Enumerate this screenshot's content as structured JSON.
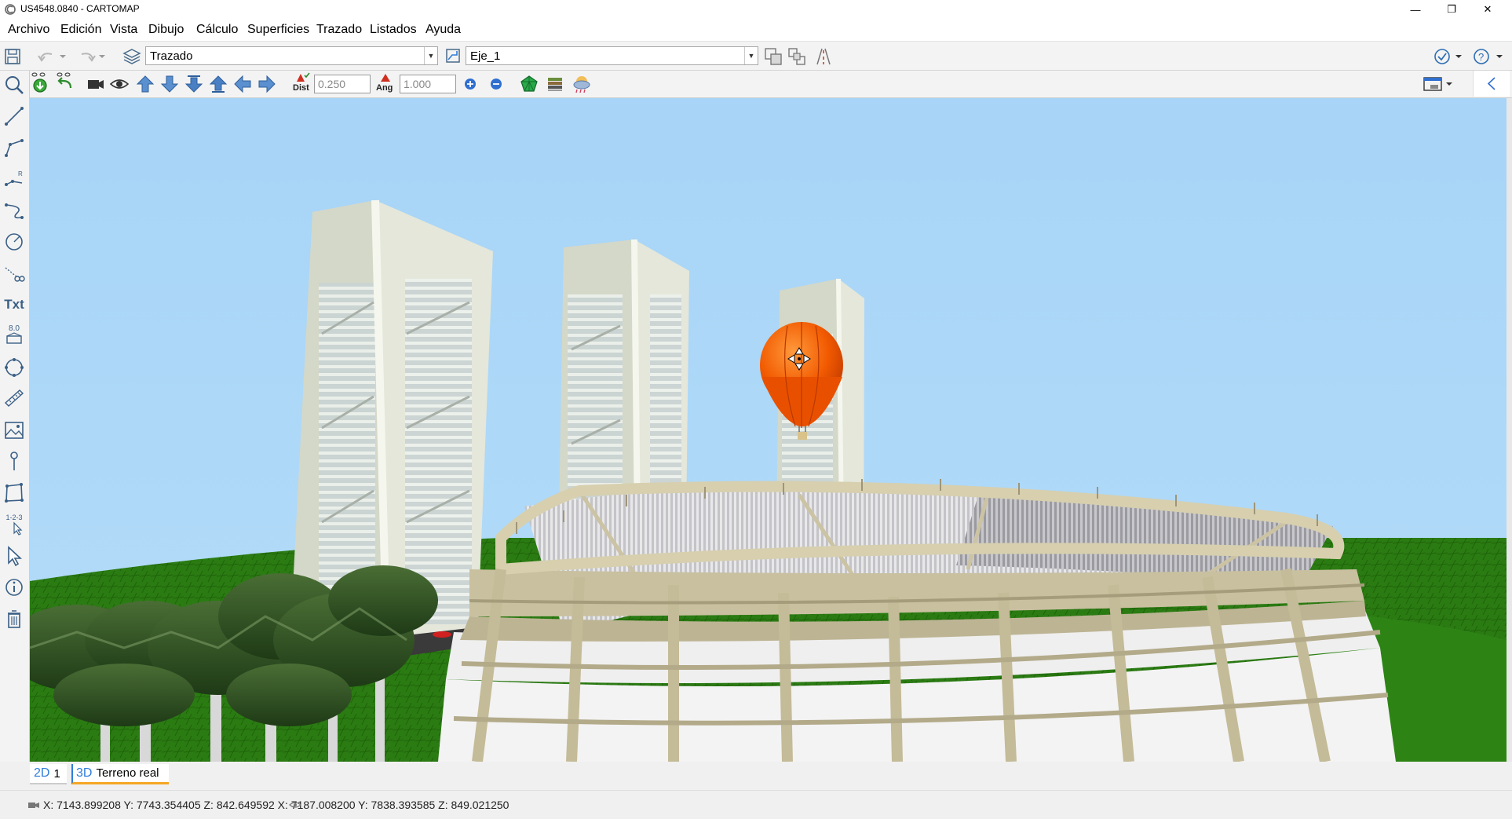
{
  "window": {
    "title": "US4548.0840 - CARTOMAP",
    "minimize": "—",
    "restore": "❐",
    "close": "✕"
  },
  "menu": [
    "Archivo",
    "Edición",
    "Vista",
    "Dibujo",
    "Cálculo",
    "Superficies",
    "Trazado",
    "Listados",
    "Ayuda"
  ],
  "toolbar1": {
    "layer_value": "Trazado",
    "axis_value": "Eje_1"
  },
  "toolbar2": {
    "dist_label": "Dist",
    "dist_value": "0.250",
    "ang_label": "Ang",
    "ang_value": "1.000"
  },
  "lefttoolbar": {
    "text_tool_label": "Txt",
    "level_label": "8.0",
    "numbering_label": "1-2-3"
  },
  "tabs": [
    {
      "dim": "2D",
      "label": "1"
    },
    {
      "dim": "3D",
      "label": "Terreno real"
    }
  ],
  "status": {
    "coords": "X: 7143.899208  Y: 7743.354405  Z: 842.649592      X: 7187.008200  Y: 7838.393585  Z: 849.021250"
  },
  "colors": {
    "sky": "#a9d6f8",
    "grass": "#2a7a12",
    "balloon": "#f05a00",
    "building": "#d9dccd",
    "stadium": "#cbc3a3",
    "active_tab": "#f5a623"
  }
}
